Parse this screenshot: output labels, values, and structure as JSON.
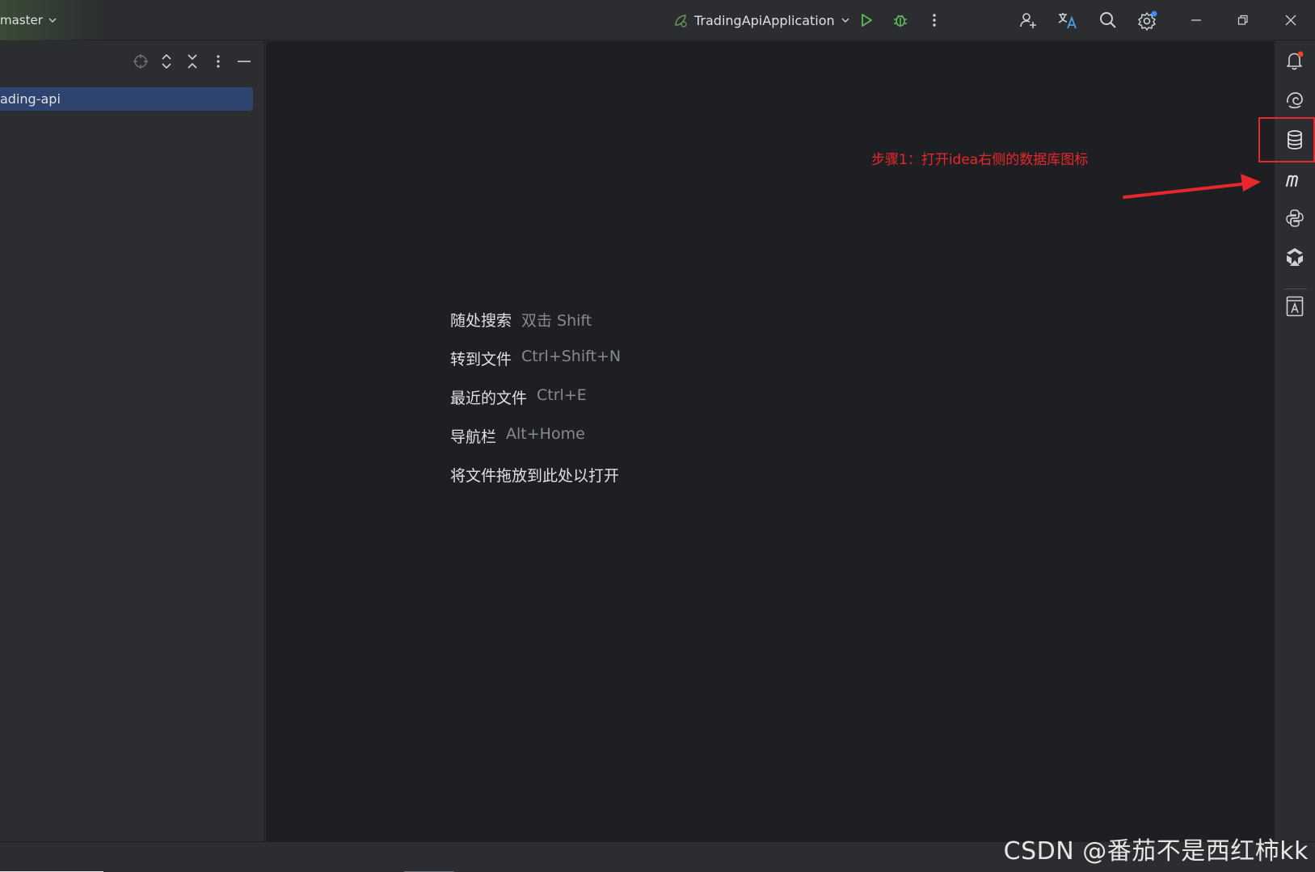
{
  "titlebar": {
    "branch": "master",
    "run_config": "TradingApiApplication"
  },
  "project_panel": {
    "selected_item": "ading-api"
  },
  "editor": {
    "hints": [
      {
        "action": "随处搜索",
        "shortcut": "双击 Shift"
      },
      {
        "action": "转到文件",
        "shortcut": "Ctrl+Shift+N"
      },
      {
        "action": "最近的文件",
        "shortcut": "Ctrl+E"
      },
      {
        "action": "导航栏",
        "shortcut": "Alt+Home"
      },
      {
        "action": "将文件拖放到此处以打开",
        "shortcut": ""
      }
    ],
    "annotation": "步骤1：打开idea右侧的数据库图标"
  },
  "right_strip": {
    "icons": [
      "notifications-icon",
      "ai-assistant-icon",
      "database-icon",
      "maven-icon",
      "python-console-icon",
      "plugin-icon",
      "text-tool-icon"
    ]
  },
  "colors": {
    "accent_red": "#e8272d",
    "selection": "#2e436e",
    "run_green": "#5fb85a"
  },
  "watermark": "CSDN @番茄不是西红柿kk"
}
